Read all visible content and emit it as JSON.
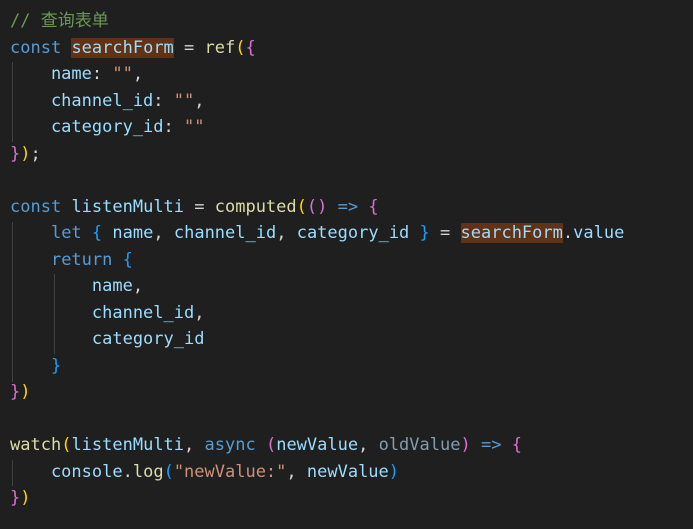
{
  "editor": {
    "colors": {
      "background": "#1f1f1f",
      "comment": "#6a9955",
      "keyword": "#569cd6",
      "control_keyword": "#c586c0",
      "variable": "#9cdcfe",
      "function": "#dcdcaa",
      "string": "#ce9178",
      "bracket_level1": "#ffd700",
      "bracket_level2": "#da70d6",
      "bracket_level3": "#179fff",
      "match_highlight": "#613214"
    },
    "highlighted_word": "searchForm",
    "lines": [
      {
        "tokens": [
          {
            "t": "// 查询表单",
            "c": "cm"
          }
        ]
      },
      {
        "tokens": [
          {
            "t": "const",
            "c": "kw"
          },
          {
            "t": " ",
            "c": "pn"
          },
          {
            "t": "searchForm",
            "c": "var",
            "hl": true
          },
          {
            "t": " = ",
            "c": "pn"
          },
          {
            "t": "ref",
            "c": "fn"
          },
          {
            "t": "(",
            "c": "b1"
          },
          {
            "t": "{",
            "c": "b2"
          }
        ]
      },
      {
        "tokens": [
          {
            "t": "    name",
            "c": "var"
          },
          {
            "t": ": ",
            "c": "pn"
          },
          {
            "t": "\"\"",
            "c": "str"
          },
          {
            "t": ",",
            "c": "pn"
          }
        ]
      },
      {
        "tokens": [
          {
            "t": "    channel_id",
            "c": "var"
          },
          {
            "t": ": ",
            "c": "pn"
          },
          {
            "t": "\"\"",
            "c": "str"
          },
          {
            "t": ",",
            "c": "pn"
          }
        ]
      },
      {
        "tokens": [
          {
            "t": "    category_id",
            "c": "var"
          },
          {
            "t": ": ",
            "c": "pn"
          },
          {
            "t": "\"\"",
            "c": "str"
          }
        ]
      },
      {
        "tokens": [
          {
            "t": "}",
            "c": "b2"
          },
          {
            "t": ")",
            "c": "b1"
          },
          {
            "t": ";",
            "c": "pn"
          }
        ]
      },
      {
        "tokens": []
      },
      {
        "tokens": [
          {
            "t": "const",
            "c": "kw"
          },
          {
            "t": " ",
            "c": "pn"
          },
          {
            "t": "listenMulti",
            "c": "var"
          },
          {
            "t": " = ",
            "c": "pn"
          },
          {
            "t": "computed",
            "c": "fn"
          },
          {
            "t": "(",
            "c": "b1"
          },
          {
            "t": "()",
            "c": "b2"
          },
          {
            "t": " ",
            "c": "pn"
          },
          {
            "t": "=>",
            "c": "kw"
          },
          {
            "t": " ",
            "c": "pn"
          },
          {
            "t": "{",
            "c": "b2"
          }
        ]
      },
      {
        "tokens": [
          {
            "t": "    ",
            "c": "pn"
          },
          {
            "t": "let",
            "c": "kw"
          },
          {
            "t": " ",
            "c": "pn"
          },
          {
            "t": "{",
            "c": "b3"
          },
          {
            "t": " ",
            "c": "pn"
          },
          {
            "t": "name",
            "c": "var"
          },
          {
            "t": ", ",
            "c": "pn"
          },
          {
            "t": "channel_id",
            "c": "var"
          },
          {
            "t": ", ",
            "c": "pn"
          },
          {
            "t": "category_id",
            "c": "var"
          },
          {
            "t": " ",
            "c": "pn"
          },
          {
            "t": "}",
            "c": "b3"
          },
          {
            "t": " = ",
            "c": "pn"
          },
          {
            "t": "searchForm",
            "c": "var",
            "hl": true
          },
          {
            "t": ".",
            "c": "pn"
          },
          {
            "t": "value",
            "c": "var"
          }
        ]
      },
      {
        "tokens": [
          {
            "t": "    ",
            "c": "pn"
          },
          {
            "t": "return",
            "c": "kw"
          },
          {
            "t": " ",
            "c": "pn"
          },
          {
            "t": "{",
            "c": "b3"
          }
        ]
      },
      {
        "tokens": [
          {
            "t": "        name",
            "c": "var"
          },
          {
            "t": ",",
            "c": "pn"
          }
        ]
      },
      {
        "tokens": [
          {
            "t": "        channel_id",
            "c": "var"
          },
          {
            "t": ",",
            "c": "pn"
          }
        ]
      },
      {
        "tokens": [
          {
            "t": "        category_id",
            "c": "var"
          }
        ]
      },
      {
        "tokens": [
          {
            "t": "    ",
            "c": "pn"
          },
          {
            "t": "}",
            "c": "b3"
          }
        ]
      },
      {
        "tokens": [
          {
            "t": "}",
            "c": "b2"
          },
          {
            "t": ")",
            "c": "b1"
          }
        ]
      },
      {
        "tokens": []
      },
      {
        "tokens": [
          {
            "t": "watch",
            "c": "fn"
          },
          {
            "t": "(",
            "c": "b1"
          },
          {
            "t": "listenMulti",
            "c": "var"
          },
          {
            "t": ", ",
            "c": "pn"
          },
          {
            "t": "async",
            "c": "kw"
          },
          {
            "t": " ",
            "c": "pn"
          },
          {
            "t": "(",
            "c": "b2"
          },
          {
            "t": "newValue",
            "c": "var"
          },
          {
            "t": ", ",
            "c": "pn"
          },
          {
            "t": "oldValue",
            "c": "param-faded"
          },
          {
            "t": ")",
            "c": "b2"
          },
          {
            "t": " ",
            "c": "pn"
          },
          {
            "t": "=>",
            "c": "kw"
          },
          {
            "t": " ",
            "c": "pn"
          },
          {
            "t": "{",
            "c": "b2"
          }
        ]
      },
      {
        "tokens": [
          {
            "t": "    console",
            "c": "var"
          },
          {
            "t": ".",
            "c": "pn"
          },
          {
            "t": "log",
            "c": "fn"
          },
          {
            "t": "(",
            "c": "b3"
          },
          {
            "t": "\"newValue:\"",
            "c": "str"
          },
          {
            "t": ", ",
            "c": "pn"
          },
          {
            "t": "newValue",
            "c": "var"
          },
          {
            "t": ")",
            "c": "b3"
          }
        ]
      },
      {
        "tokens": [
          {
            "t": "}",
            "c": "b2"
          },
          {
            "t": ")",
            "c": "b1"
          }
        ]
      }
    ]
  }
}
